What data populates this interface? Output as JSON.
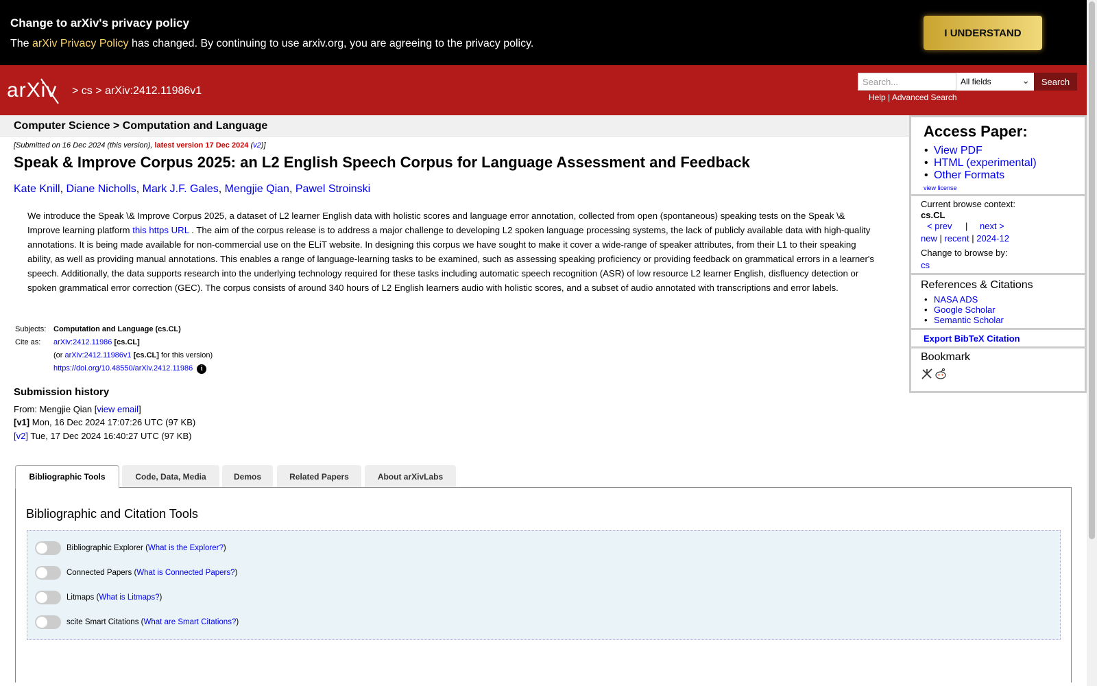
{
  "privacy": {
    "title": "Change to arXiv's privacy policy",
    "text_pre": "The ",
    "link": "arXiv Privacy Policy",
    "text_post": " has changed. By continuing to use arxiv.org, you are agreeing to the privacy policy.",
    "button": "I UNDERSTAND"
  },
  "header": {
    "logo_text": "arXiv",
    "crumb_cs": "cs",
    "crumb_id": "arXiv:2412.11986v1",
    "sep": ">",
    "search_placeholder": "Search...",
    "field_select": "All fields",
    "search_button": "Search",
    "help": "Help",
    "advanced": "Advanced Search",
    "pipe": " | "
  },
  "subheader": "Computer Science > Computation and Language",
  "paper": {
    "submitted": "[Submitted on 16 Dec 2024 (this version), ",
    "latest": "latest version 17 Dec 2024",
    "v2": "v2",
    "title": "Speak & Improve Corpus 2025: an L2 English Speech Corpus for Language Assessment and Feedback",
    "authors": [
      "Kate Knill",
      "Diane Nicholls",
      "Mark J.F. Gales",
      "Mengjie Qian",
      "Pawel Stroinski"
    ],
    "abstract_1": "We introduce the Speak \\& Improve Corpus 2025, a dataset of L2 learner English data with holistic scores and language error annotation, collected from open (spontaneous) speaking tests on the Speak \\& Improve learning platform ",
    "abstract_link": "this https URL",
    "abstract_2": " . The aim of the corpus release is to address a major challenge to developing L2 spoken language processing systems, the lack of publicly available data with high-quality annotations. It is being made available for non-commercial use on the ELiT website. In designing this corpus we have sought to make it cover a wide-range of speaker attributes, from their L1 to their speaking ability, as well as providing manual annotations. This enables a range of language-learning tasks to be examined, such as assessing speaking proficiency or providing feedback on grammatical errors in a learner's speech. Additionally, the data supports research into the underlying technology required for these tasks including automatic speech recognition (ASR) of low resource L2 learner English, disfluency detection or spoken grammatical error correction (GEC). The corpus consists of around 340 hours of L2 English learners audio with holistic scores, and a subset of audio annotated with transcriptions and error labels."
  },
  "meta": {
    "subjects_label": "Subjects:",
    "subjects": "Computation and Language (cs.CL)",
    "cite_label": "Cite as:",
    "cite_id": "arXiv:2412.11986",
    "cite_cat": "[cs.CL]",
    "cite_or": "(or ",
    "cite_vid": "arXiv:2412.11986v1",
    "cite_for": " for this version)",
    "doi": "https://doi.org/10.48550/arXiv.2412.11986",
    "info": "i"
  },
  "history": {
    "title": "Submission history",
    "from": "From: Mengjie Qian [",
    "view_email": "view email",
    "close": "]",
    "v1_label": "[v1]",
    "v1": " Mon, 16 Dec 2024 17:07:26 UTC (97 KB)",
    "v2_label": "[v2]",
    "v2": " Tue, 17 Dec 2024 16:40:27 UTC (97 KB)"
  },
  "sidebar": {
    "access_title": "Access Paper:",
    "access_links": [
      "View PDF",
      "HTML (experimental)",
      "Other Formats"
    ],
    "view_license": "view license",
    "browse_context_label": "Current browse context:",
    "browse_context": "cs.CL",
    "prev": "< prev",
    "pipe": "|",
    "next": "next >",
    "new": "new",
    "recent": "recent",
    "month": "2024-12",
    "change_browse": "Change to browse by:",
    "browse_cs": "cs",
    "refs_title": "References & Citations",
    "refs": [
      "NASA ADS",
      "Google Scholar",
      "Semantic Scholar"
    ],
    "bibtex": "Export BibTeX Citation",
    "bookmark": "Bookmark"
  },
  "tabs": [
    "Bibliographic Tools",
    "Code, Data, Media",
    "Demos",
    "Related Papers",
    "About arXivLabs"
  ],
  "panel": {
    "title": "Bibliographic and Citation Tools",
    "tools": [
      {
        "name": "Bibliographic Explorer",
        "link": "What is the Explorer?"
      },
      {
        "name": "Connected Papers",
        "link": "What is Connected Papers?"
      },
      {
        "name": "Litmaps",
        "link": "What is Litmaps?"
      },
      {
        "name": "scite Smart Citations",
        "link": "What are Smart Citations?"
      }
    ]
  },
  "colors": {
    "header_red": "#b31b1b",
    "link_blue": "#0000ee",
    "banner_black": "#000000",
    "button_gold": "#e0c250"
  }
}
